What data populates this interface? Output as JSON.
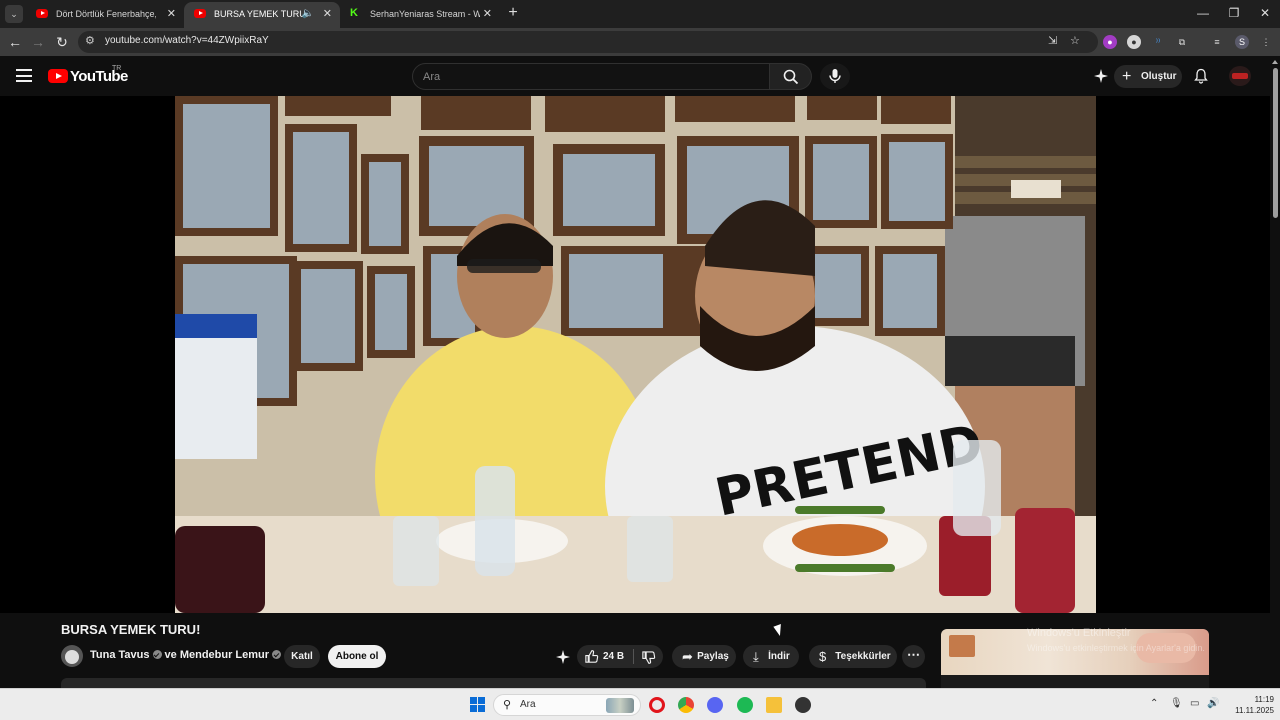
{
  "browser": {
    "tabs": [
      {
        "title": "Dört Dörtlük Fenerbahçe, Kocae",
        "favicon": "youtube-icon",
        "active": false
      },
      {
        "title": "BURSA YEMEK TURU! - You",
        "favicon": "youtube-icon",
        "active": true,
        "audio": true
      },
      {
        "title": "SerhanYeniaras Stream - Watch",
        "favicon": "kick-icon",
        "active": false
      }
    ],
    "url": "youtube.com/watch?v=44ZWpiixRaY",
    "profile_initial": "S"
  },
  "youtube": {
    "logo_text": "YouTube",
    "country_code": "TR",
    "search_placeholder": "Ara",
    "create_label": "Oluştur"
  },
  "video": {
    "title": "BURSA YEMEK TURU!",
    "channel_primary": "Tuna Tavus",
    "channel_connector": "ve",
    "channel_secondary": "Mendebur Lemur",
    "join_label": "Katıl",
    "subscribe_label": "Abone ol",
    "like_count": "24 B",
    "share_label": "Paylaş",
    "download_label": "İndir",
    "thanks_label": "Teşekkürler"
  },
  "overlay": {
    "activation_line1": "Windows'u Etkinleştir",
    "activation_line2": "Windows'u etkinleştirmek için Ayarlar'a gidin."
  },
  "taskbar": {
    "search_label": "Ara",
    "time": "11:19",
    "date": "11.11.2025"
  },
  "colors": {
    "youtube_red": "#ff0000",
    "kick_green": "#53fc18",
    "background": "#0f0f0f"
  }
}
